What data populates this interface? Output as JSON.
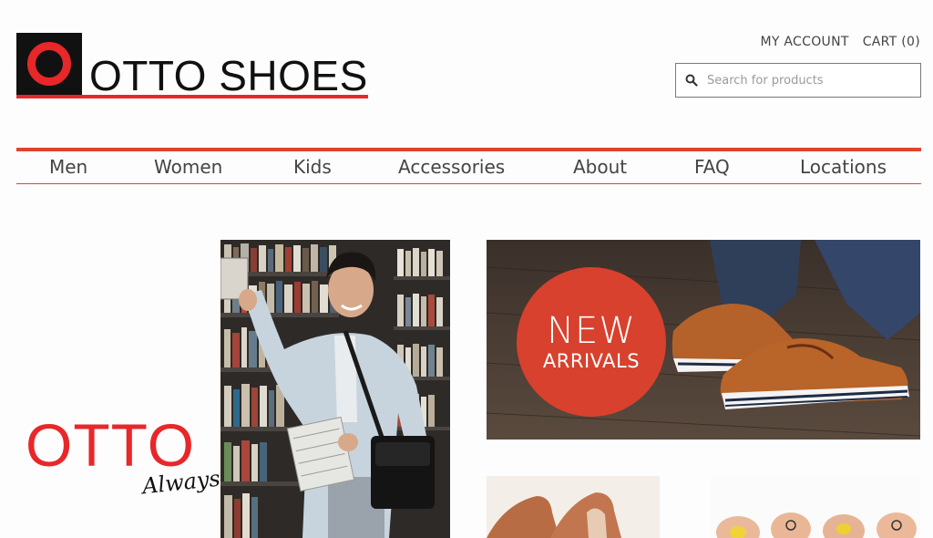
{
  "brand": {
    "logo_text": "OTTO SHOES",
    "tagline_main": "OTTO",
    "tagline_script": "Always"
  },
  "header": {
    "my_account": "MY ACCOUNT",
    "cart": "CART (0)"
  },
  "search": {
    "placeholder": "Search for products",
    "value": ""
  },
  "nav": {
    "items": [
      {
        "label": "Men"
      },
      {
        "label": "Women"
      },
      {
        "label": "Kids"
      },
      {
        "label": "Accessories"
      },
      {
        "label": "About"
      },
      {
        "label": "FAQ"
      },
      {
        "label": "Locations"
      }
    ]
  },
  "banner": {
    "line1": "NEW",
    "line2": "ARRIVALS"
  },
  "colors": {
    "accent": "#e0432f",
    "logo_red": "#e8272a",
    "text": "#444444"
  }
}
